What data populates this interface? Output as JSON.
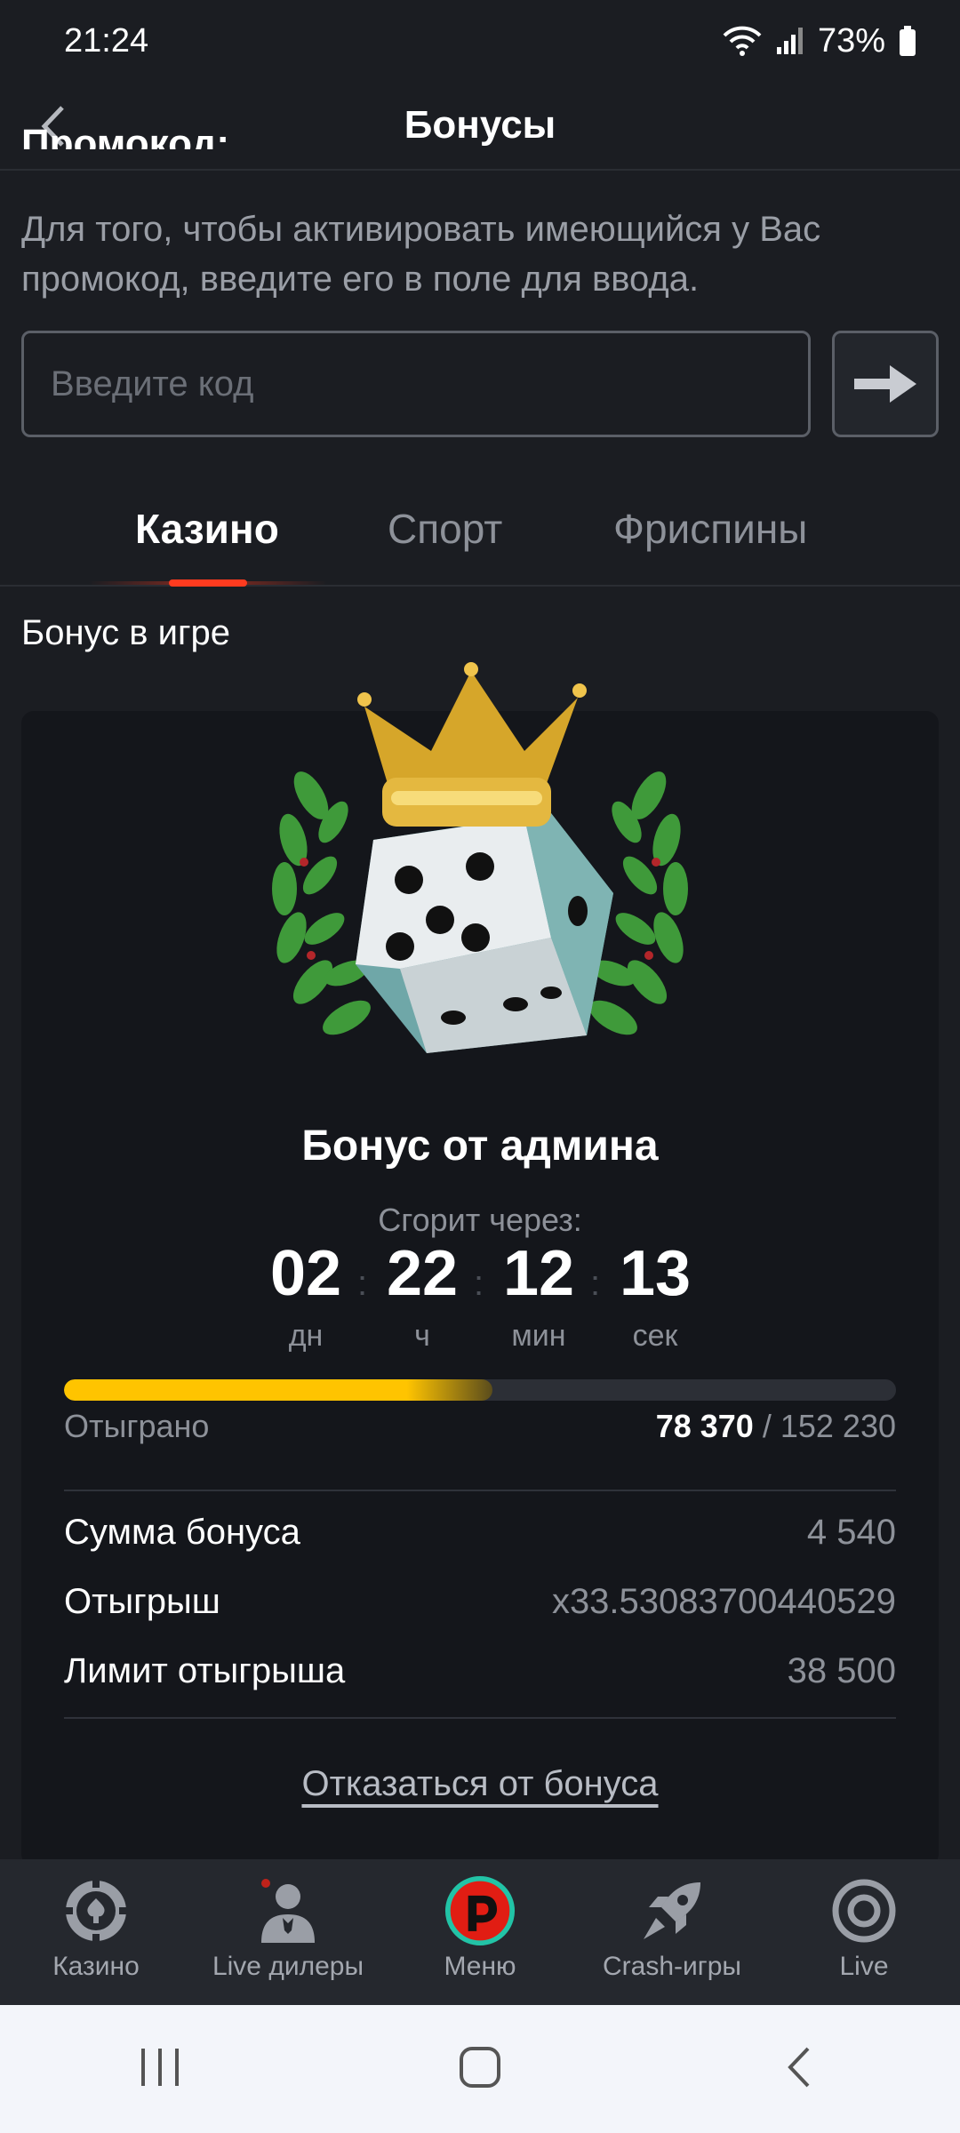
{
  "status_bar": {
    "time": "21:24",
    "battery": "73%"
  },
  "header": {
    "title": "Бонусы"
  },
  "promo": {
    "heading": "Промокод:",
    "description": "Для того, чтобы активировать имеющийся у Вас промокод, введите его в поле для ввода.",
    "input_placeholder": "Введите код"
  },
  "tabs": [
    {
      "label": "Казино",
      "active": true
    },
    {
      "label": "Спорт",
      "active": false
    },
    {
      "label": "Фриспины",
      "active": false
    }
  ],
  "section_title": "Бонус в игре",
  "bonus": {
    "name": "Бонус от админа",
    "burn_label": "Сгорит через:",
    "countdown": [
      {
        "value": "02",
        "unit": "дн"
      },
      {
        "value": "22",
        "unit": "ч"
      },
      {
        "value": "12",
        "unit": "мин"
      },
      {
        "value": "13",
        "unit": "сек"
      }
    ],
    "progress": {
      "label": "Отыграно",
      "current": "78 370",
      "separator": "/",
      "total": "152 230",
      "fraction": 0.515
    },
    "details": [
      {
        "label": "Сумма бонуса",
        "value": "4 540"
      },
      {
        "label": "Отыгрыш",
        "value": "x33.53083700440529"
      },
      {
        "label": "Лимит отыгрыша",
        "value": "38 500"
      }
    ],
    "decline_label": "Отказаться от бонуса"
  },
  "bottom_nav": [
    {
      "label": "Казино",
      "icon": "casino-chip-icon"
    },
    {
      "label": "Live дилеры",
      "icon": "dealer-icon"
    },
    {
      "label": "Меню",
      "icon": "menu-logo-icon"
    },
    {
      "label": "Crash-игры",
      "icon": "rocket-icon"
    },
    {
      "label": "Live",
      "icon": "live-target-icon"
    }
  ],
  "colors": {
    "accent": "#ff3b1f",
    "progress": "#ffc400",
    "logo_ring": "#22c3a6"
  }
}
